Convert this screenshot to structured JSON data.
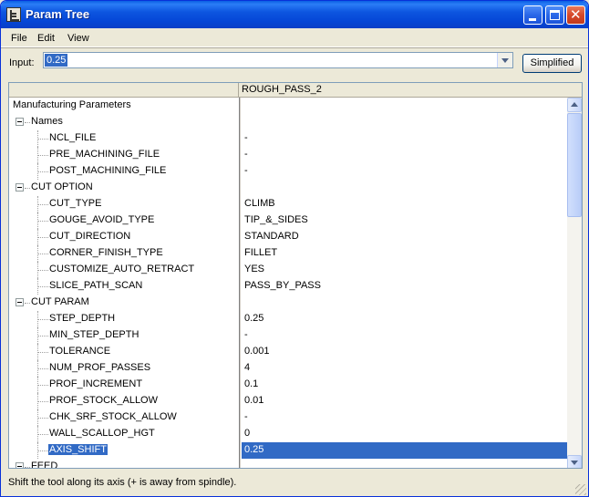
{
  "window": {
    "title": "Param Tree"
  },
  "menu": {
    "file": "File",
    "edit": "Edit",
    "view": "View"
  },
  "input": {
    "label": "Input:",
    "value": "0.25"
  },
  "buttons": {
    "simplified": "Simplified"
  },
  "grid": {
    "column_header": "ROUGH_PASS_2",
    "rows": [
      {
        "label": "Manufacturing Parameters",
        "value": ""
      },
      {
        "label": "Names",
        "value": ""
      },
      {
        "label": "NCL_FILE",
        "value": "-"
      },
      {
        "label": "PRE_MACHINING_FILE",
        "value": "-"
      },
      {
        "label": "POST_MACHINING_FILE",
        "value": "-"
      },
      {
        "label": "CUT OPTION",
        "value": ""
      },
      {
        "label": "CUT_TYPE",
        "value": "CLIMB"
      },
      {
        "label": "GOUGE_AVOID_TYPE",
        "value": "TIP_&_SIDES"
      },
      {
        "label": "CUT_DIRECTION",
        "value": "STANDARD"
      },
      {
        "label": "CORNER_FINISH_TYPE",
        "value": "FILLET"
      },
      {
        "label": "CUSTOMIZE_AUTO_RETRACT",
        "value": "YES"
      },
      {
        "label": "SLICE_PATH_SCAN",
        "value": "PASS_BY_PASS"
      },
      {
        "label": "CUT PARAM",
        "value": ""
      },
      {
        "label": "STEP_DEPTH",
        "value": "0.25"
      },
      {
        "label": "MIN_STEP_DEPTH",
        "value": "-"
      },
      {
        "label": "TOLERANCE",
        "value": "0.001"
      },
      {
        "label": "NUM_PROF_PASSES",
        "value": "4"
      },
      {
        "label": "PROF_INCREMENT",
        "value": "0.1"
      },
      {
        "label": "PROF_STOCK_ALLOW",
        "value": "0.01"
      },
      {
        "label": "CHK_SRF_STOCK_ALLOW",
        "value": "-"
      },
      {
        "label": "WALL_SCALLOP_HGT",
        "value": "0"
      },
      {
        "label": "AXIS_SHIFT",
        "value": "0.25"
      },
      {
        "label": "FEED",
        "value": ""
      }
    ]
  },
  "status": {
    "text": "Shift the tool along its axis (+ is away from spindle)."
  }
}
